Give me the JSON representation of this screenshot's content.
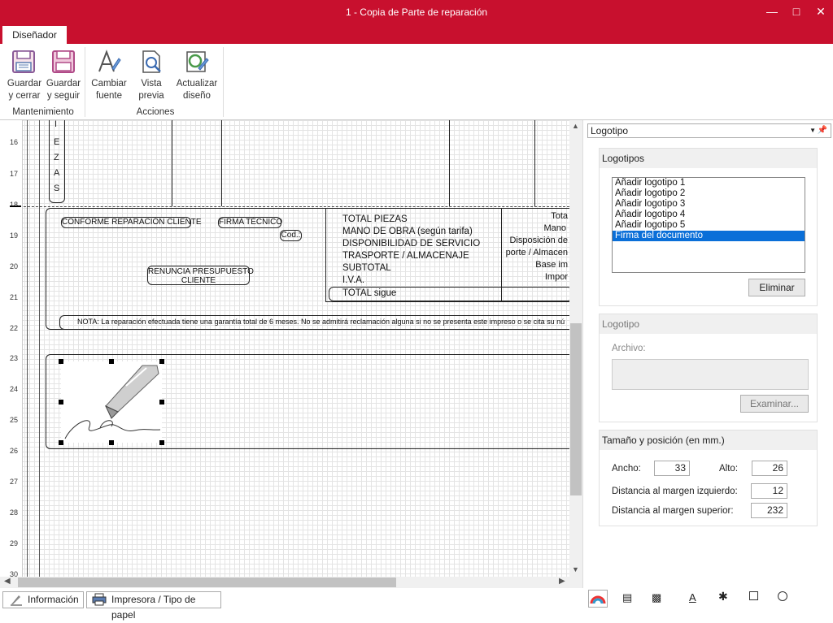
{
  "window": {
    "title": "1 - Copia de Parte de reparación"
  },
  "ribbon": {
    "tab": "Diseñador",
    "groups": [
      {
        "label": "Mantenimiento",
        "buttons": [
          {
            "line1": "Guardar",
            "line2": "y cerrar"
          },
          {
            "line1": "Guardar",
            "line2": "y seguir"
          }
        ]
      },
      {
        "label": "Acciones",
        "buttons": [
          {
            "line1": "Cambiar",
            "line2": "fuente"
          },
          {
            "line1": "Vista",
            "line2": "previa"
          },
          {
            "line1": "Actualizar",
            "line2": "diseño"
          }
        ]
      }
    ]
  },
  "ruler": {
    "marks": [
      "16",
      "17",
      "18",
      "19",
      "20",
      "21",
      "22",
      "23",
      "24",
      "25",
      "26",
      "27",
      "28",
      "29",
      "30"
    ]
  },
  "report": {
    "piezas_letters": [
      "I",
      "E",
      "Z",
      "A",
      "S"
    ],
    "conforme": "CONFORME REPARACIÓN CLIENTE",
    "firma_tecnico": "FIRMA TÉCNICO",
    "cod": "Cod.:",
    "renuncia_line1": "RENUNCIA PRESUPUESTO",
    "renuncia_line2": "CLIENTE",
    "totals": [
      "TOTAL PIEZAS",
      "MANO DE OBRA (según tarifa)",
      "DISPONIBILIDAD DE SERVICIO",
      "TRASPORTE / ALMACENAJE",
      "SUBTOTAL",
      "I.V.A."
    ],
    "total_sigue": "TOTAL sigue",
    "right_col": [
      "Tota",
      "Mano",
      "Disposición de",
      "porte / Almacen",
      "Base im",
      "Impor"
    ],
    "nota": "NOTA: La reparación efectuada tiene una garantía total de 6 meses. No se admitirá reclamación alguna si no se presenta   este impreso o se cita su nú"
  },
  "panel": {
    "combo": "Logotipo",
    "logotipos": {
      "header": "Logotipos",
      "items": [
        "Añadir logotipo 1",
        "Añadir logotipo 2",
        "Añadir logotipo 3",
        "Añadir logotipo 4",
        "Añadir logotipo 5",
        "Firma del documento"
      ],
      "selected_index": 5,
      "delete_label": "Eliminar"
    },
    "logotipo": {
      "header": "Logotipo",
      "archivo_label": "Archivo:",
      "browse_label": "Examinar..."
    },
    "size": {
      "header": "Tamaño y posición (en mm.)",
      "ancho_label": "Ancho:",
      "ancho": "33",
      "alto_label": "Alto:",
      "alto": "26",
      "izq_label": "Distancia al margen izquierdo:",
      "izq": "12",
      "sup_label": "Distancia al margen superior:",
      "sup": "232"
    }
  },
  "bottom_tabs": {
    "info": "Información",
    "printer": "Impresora / Tipo de papel"
  },
  "colors": {
    "accent": "#c8102e",
    "selection": "#0a6fd8"
  }
}
